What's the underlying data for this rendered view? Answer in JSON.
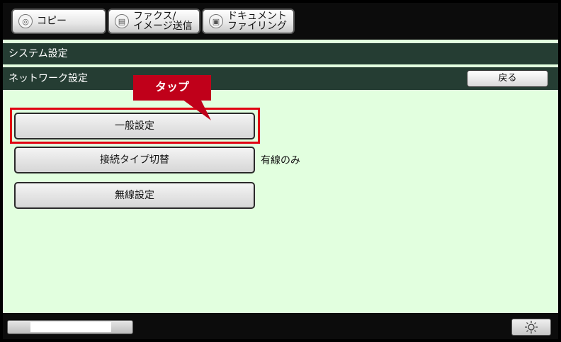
{
  "tabs": [
    {
      "label_lines": [
        "コピー"
      ]
    },
    {
      "label_lines": [
        "ファクス/",
        "イメージ送信"
      ]
    },
    {
      "label_lines": [
        "ドキュメント",
        "ファイリング"
      ]
    }
  ],
  "header": {
    "title": "システム設定",
    "subtitle": "ネットワーク設定",
    "back_label": "戻る"
  },
  "callout": {
    "text": "タップ",
    "color": "#c0001a"
  },
  "menu": {
    "items": [
      {
        "label": "一般設定",
        "highlighted": true
      },
      {
        "label": "接続タイプ切替",
        "value": "有線のみ"
      },
      {
        "label": "無線設定"
      }
    ]
  },
  "colors": {
    "background": "#e2ffdf",
    "title_bar": "#253d33",
    "highlight_border": "#e00012"
  },
  "icons": [
    "copy-icon",
    "fax-icon",
    "document-filing-icon",
    "brightness-icon"
  ]
}
